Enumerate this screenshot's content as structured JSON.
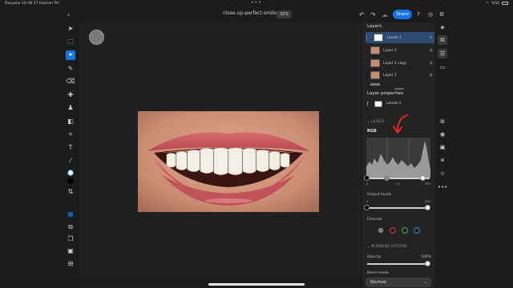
{
  "status_bar": {
    "left": "Dosyalar  16:48  27 Haziran Prt",
    "battery": "%50"
  },
  "document": {
    "title": "close-up-perfect-smile *",
    "zoom": "32%"
  },
  "header": {
    "share_label": "Share"
  },
  "layers": {
    "title": "Layers",
    "items": [
      {
        "name": "Levels 1"
      },
      {
        "name": "Layer 2"
      },
      {
        "name": "Layer 1 copy"
      },
      {
        "name": "Layer 1"
      }
    ]
  },
  "layer_properties": {
    "title": "Layer properties",
    "selected_layer": "Levels 1",
    "section": "LEVELS",
    "channel_label": "RGB",
    "input_levels": {
      "black": "0",
      "mid": "1,0",
      "white": "229"
    },
    "output_levels_label": "Output levels",
    "output_min": "0",
    "output_max": "255",
    "channel_title": "Channel",
    "blending_section": "BLENDING OPTIONS",
    "opacity_label": "Opacity",
    "opacity_value": "100%",
    "blend_mode_label": "Blend mode",
    "blend_mode_value": "Normal"
  },
  "icons": {
    "accent": "#1473e6",
    "annotation_arrow": "#d42a20"
  }
}
